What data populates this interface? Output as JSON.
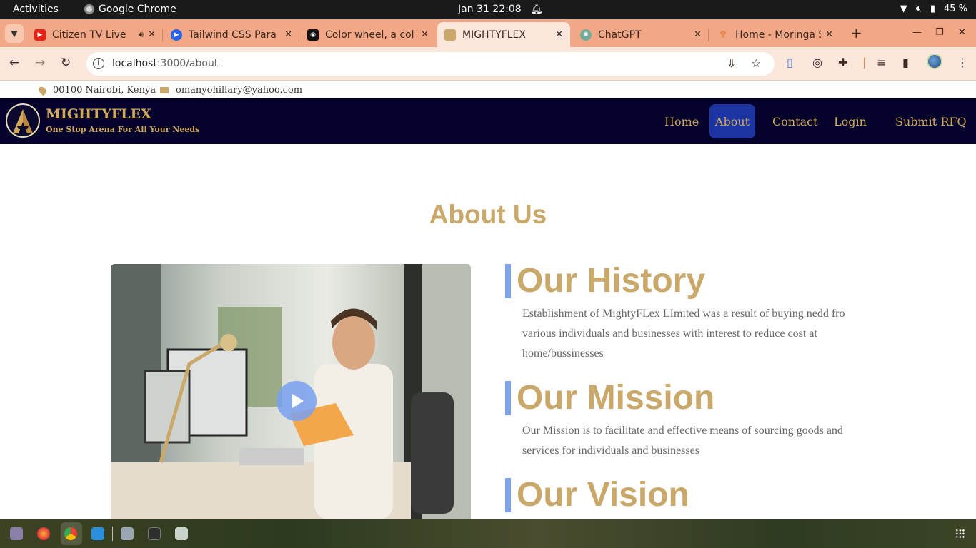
{
  "system_bar": {
    "activities": "Activities",
    "app_name": "Google Chrome",
    "clock": "Jan 31  22:08",
    "battery": "45 %"
  },
  "tabs": [
    {
      "title": "Citizen TV Live",
      "favicon_color": "#e62117",
      "favicon": "youtube-icon"
    },
    {
      "title": "Tailwind CSS Para",
      "favicon_color": "#2563eb",
      "favicon": "tailwind-icon"
    },
    {
      "title": "Color wheel, a col",
      "favicon_color": "#111111",
      "favicon": "colorwheel-icon"
    },
    {
      "title": "MIGHTYFLEX",
      "favicon_color": "#c9a86a",
      "favicon": "mightyflex-icon",
      "active": true
    },
    {
      "title": "ChatGPT",
      "favicon_color": "#74aa9c",
      "favicon": "chatgpt-icon"
    },
    {
      "title": "Home - Moringa S",
      "favicon_color": "#e8843a",
      "favicon": "moringa-icon"
    }
  ],
  "address_bar": {
    "host": "localhost",
    "path": ":3000/about"
  },
  "contact": {
    "location": "00100 Nairobi, Kenya",
    "email": "omanyohillary@yahoo.com"
  },
  "brand": {
    "name": "MIGHTYFLEX",
    "tagline": "One Stop Arena For All Your Needs",
    "color": "#d1a95c"
  },
  "nav": {
    "home": "Home",
    "about": "About",
    "contact": "Contact",
    "login": "Login",
    "submit_rfq": "Submit RFQ"
  },
  "about": {
    "title": "About Us",
    "history_title": "Our History",
    "history_text": "Establishment of MightyFLex LImited was a result of buying nedd fro various individuals and businesses with interest to reduce cost at home/bussinesses",
    "mission_title": "Our Mission",
    "mission_text": "Our Mission is to facilitate and effective means of sourcing goods and services for individuals and businesses",
    "vision_title": "Our Vision"
  }
}
